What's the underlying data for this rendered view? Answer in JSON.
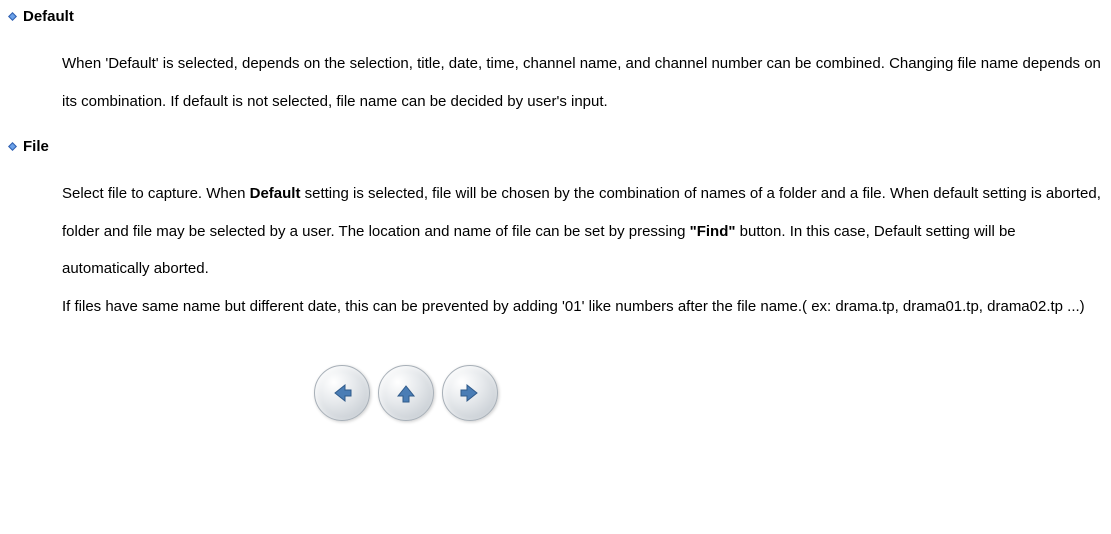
{
  "sections": {
    "default": {
      "title": "Default",
      "body": "When 'Default' is selected, depends on the selection, title, date, time, channel name, and channel number can be combined. Changing file name depends on its combination. If default is not selected, file name can be decided by user's input."
    },
    "file": {
      "title": "File",
      "body_pre": "Select file to capture. When ",
      "body_bold1": "Default",
      "body_mid1": " setting is selected, file will be chosen by the combination of names of a folder and a file.   When default setting is aborted, folder and file may be selected by a user.   The location and name of file can be set by pressing ",
      "body_bold2": "\"Find\"",
      "body_mid2": " button.   In this case, Default setting will be automatically aborted.",
      "body_line2": "If files have same name but different date, this can be prevented by adding '01' like numbers after the file name.( ex: drama.tp, drama01.tp, drama02.tp ...)"
    }
  }
}
